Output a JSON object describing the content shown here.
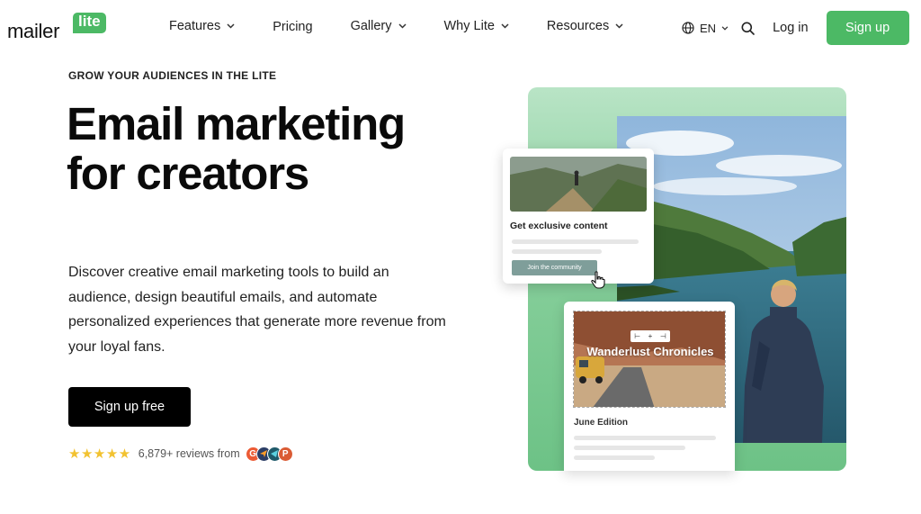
{
  "nav": {
    "logo": {
      "word": "mailer",
      "badge": "lite"
    },
    "items": [
      {
        "label": "Features",
        "dropdown": true
      },
      {
        "label": "Pricing",
        "dropdown": false
      },
      {
        "label": "Gallery",
        "dropdown": true
      },
      {
        "label": "Why Lite",
        "dropdown": true
      },
      {
        "label": "Resources",
        "dropdown": true
      }
    ],
    "language": "EN",
    "login_label": "Log in",
    "signup_label": "Sign up"
  },
  "hero": {
    "eyebrow": "GROW YOUR AUDIENCES IN THE LITE",
    "headline": "Email marketing for creators",
    "subcopy": "Discover creative email marketing tools to build an audience, design beautiful emails, and automate personalized experiences that generate more revenue from your loyal fans.",
    "cta_label": "Sign up free",
    "reviews": {
      "stars": "★★★★★",
      "text": "6,879+ reviews from",
      "badges": [
        {
          "letter": "G",
          "color": "#ec5a34"
        },
        {
          "letter": "",
          "color": "#2c3e66"
        },
        {
          "letter": "",
          "color": "#1f5a6a"
        },
        {
          "letter": "P",
          "color": "#da5b34"
        }
      ]
    }
  },
  "art": {
    "card1": {
      "title": "Get exclusive content",
      "button_label": "Join the community"
    },
    "card2": {
      "title": "Wanderlust Chronicles",
      "edition": "June Edition"
    }
  },
  "colors": {
    "brand_green": "#4cb965",
    "cta_black": "#000000",
    "star_yellow": "#f2c230"
  }
}
